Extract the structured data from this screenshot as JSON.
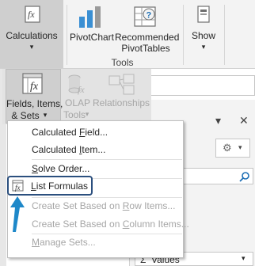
{
  "ribbon": {
    "calculations": {
      "label": "Calculations",
      "arrow": "▾"
    },
    "pivotchart": {
      "label": "PivotChart"
    },
    "recommended": {
      "line1": "Recommended",
      "line2": "PivotTables"
    },
    "group_label": "Tools",
    "show": {
      "label": "Show",
      "arrow": "▾"
    }
  },
  "submenu": {
    "fields_items_sets": {
      "line1": "Fields, Items,",
      "line2": "& Sets",
      "arrow": "▾"
    },
    "olap": {
      "line1": "OLAP",
      "line2": "Tools",
      "arrow": "▾"
    },
    "relationships": {
      "label": "Relationships"
    }
  },
  "dropdown": {
    "items": [
      {
        "pre": "Calculated ",
        "key": "F",
        "post": "ield...",
        "enabled": true
      },
      {
        "pre": "Calculated ",
        "key": "I",
        "post": "tem...",
        "enabled": true
      },
      {
        "pre": "",
        "key": "S",
        "post": "olve Order...",
        "enabled": true
      },
      {
        "pre": "",
        "key": "L",
        "post": "ist Formulas",
        "enabled": true,
        "highlighted": true
      },
      {
        "pre": "Create Set Based on ",
        "key": "R",
        "post": "ow Items...",
        "enabled": false
      },
      {
        "pre": "Create Set Based on ",
        "key": "C",
        "post": "olumn Items...",
        "enabled": false
      },
      {
        "pre": "",
        "key": "M",
        "post": "anage Sets...",
        "enabled": false
      }
    ]
  },
  "pane": {
    "close": "✕",
    "values_label": "Values",
    "sigma": "Σ",
    "arrow": "▾"
  },
  "colors": {
    "highlight_border": "#2b4f7e",
    "pointer_arrow": "#1e88c9",
    "ribbon_bg": "#f3f3f3",
    "pressed": "#cfcfcf"
  }
}
